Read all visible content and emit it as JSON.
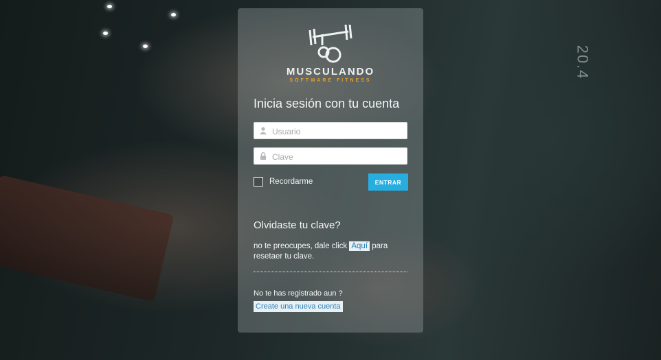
{
  "background": {
    "plate_label": "20.4"
  },
  "brand": {
    "name": "MUSCULANDO",
    "tagline": "SOFTWARE FITNESS",
    "logo_icon": "dumbbell-logo-icon",
    "accent_color": "#e0a030"
  },
  "login": {
    "title": "Inicia sesión con tu cuenta",
    "username_placeholder": "Usuario",
    "username_icon": "user-icon",
    "password_placeholder": "Clave",
    "password_icon": "lock-icon",
    "remember_label": "Recordarme",
    "submit_label": "ENTRAR",
    "submit_color": "#27aee0"
  },
  "forgot": {
    "title": "Olvidaste tu clave?",
    "text_before": "no te preocupes, dale click ",
    "link_label": "Aquí",
    "text_after": " para resetaer tu clave."
  },
  "register": {
    "question": "No te has registrado aun ?",
    "link_label": "Create una nueva cuenta"
  }
}
